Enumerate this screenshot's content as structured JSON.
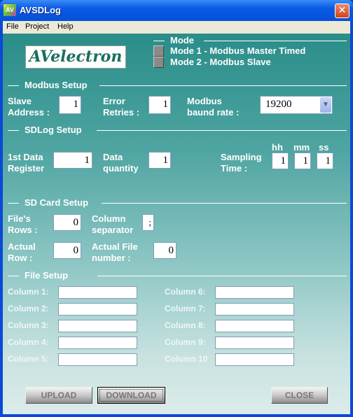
{
  "window": {
    "title": "AVSDLog",
    "close": "✕",
    "app_icon": "AV"
  },
  "menu": [
    "File",
    "Project",
    "Help"
  ],
  "logo": "AVelectron",
  "mode": {
    "header": "Mode",
    "options": [
      "Mode 1 - Modbus Master Timed",
      "Mode 2 - Modbus Slave"
    ]
  },
  "modbus": {
    "header": "Modbus Setup",
    "slave_address_label": [
      "Slave",
      "Address :"
    ],
    "slave_address": "1",
    "error_retries_label": [
      "Error",
      "Retries :"
    ],
    "error_retries": "1",
    "baud_label": [
      "Modbus",
      "baund rate :"
    ],
    "baud_rate": "19200"
  },
  "sdlog": {
    "header": "SDLog Setup",
    "first_register_label": [
      "1st Data",
      "Register"
    ],
    "first_register": "1",
    "quantity_label": [
      "Data",
      "quantity"
    ],
    "quantity": "1",
    "sampling_label": [
      "Sampling",
      "Time :"
    ],
    "hh_label": "hh",
    "mm_label": "mm",
    "ss_label": "ss",
    "hh": "1",
    "mm": "1",
    "ss": "1"
  },
  "sdcard": {
    "header": "SD Card Setup",
    "file_rows_label": [
      "File's",
      "Rows :"
    ],
    "file_rows": "0",
    "separator_label": [
      "Column",
      "separator"
    ],
    "separator": ";",
    "actual_row_label": [
      "Actual",
      "Row :"
    ],
    "actual_row": "0",
    "actual_file_label": [
      "Actual File",
      "number :"
    ],
    "actual_file": "0"
  },
  "file_setup": {
    "header": "File Setup",
    "columns": [
      "Column 1:",
      "Column 2:",
      "Column 3:",
      "Column 4:",
      "Column 5:",
      "Column 6:",
      "Column 7:",
      "Column 8:",
      "Column 9:",
      "Column 10"
    ]
  },
  "buttons": {
    "upload": "UPLOAD",
    "download": "DOWNLOAD",
    "close": "CLOSE"
  }
}
